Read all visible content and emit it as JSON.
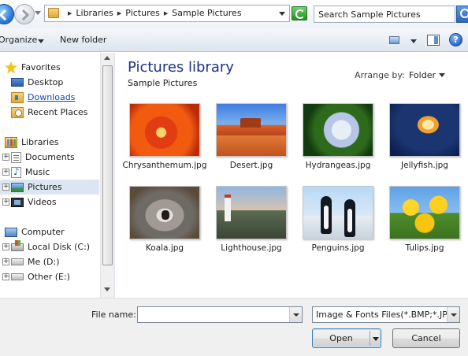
{
  "address": {
    "breadcrumbs": [
      "Libraries",
      "Pictures",
      "Sample Pictures"
    ]
  },
  "search": {
    "placeholder": "Search Sample Pictures"
  },
  "toolbar": {
    "organize_label": "Organize",
    "new_folder_label": "New folder",
    "help_label": "?"
  },
  "nav": {
    "favorites": {
      "label": "Favorites",
      "items": [
        "Desktop",
        "Downloads",
        "Recent Places"
      ]
    },
    "libraries": {
      "label": "Libraries",
      "items": [
        "Documents",
        "Music",
        "Pictures",
        "Videos"
      ]
    },
    "computer": {
      "label": "Computer",
      "items": [
        "Local Disk (C:)",
        "Me (D:)",
        "Other (E:)"
      ]
    }
  },
  "content": {
    "title": "Pictures library",
    "subtitle": "Sample Pictures",
    "arrange_label": "Arrange by:",
    "arrange_value": "Folder",
    "files": [
      {
        "name": "Chrysanthemum.jpg"
      },
      {
        "name": "Desert.jpg"
      },
      {
        "name": "Hydrangeas.jpg"
      },
      {
        "name": "Jellyfish.jpg"
      },
      {
        "name": "Koala.jpg"
      },
      {
        "name": "Lighthouse.jpg"
      },
      {
        "name": "Penguins.jpg"
      },
      {
        "name": "Tulips.jpg"
      }
    ]
  },
  "footer": {
    "file_name_label": "File name:",
    "file_name_value": "",
    "file_type": "Image & Fonts Files(*.BMP;*.JPG",
    "open_label": "Open",
    "cancel_label": "Cancel"
  }
}
